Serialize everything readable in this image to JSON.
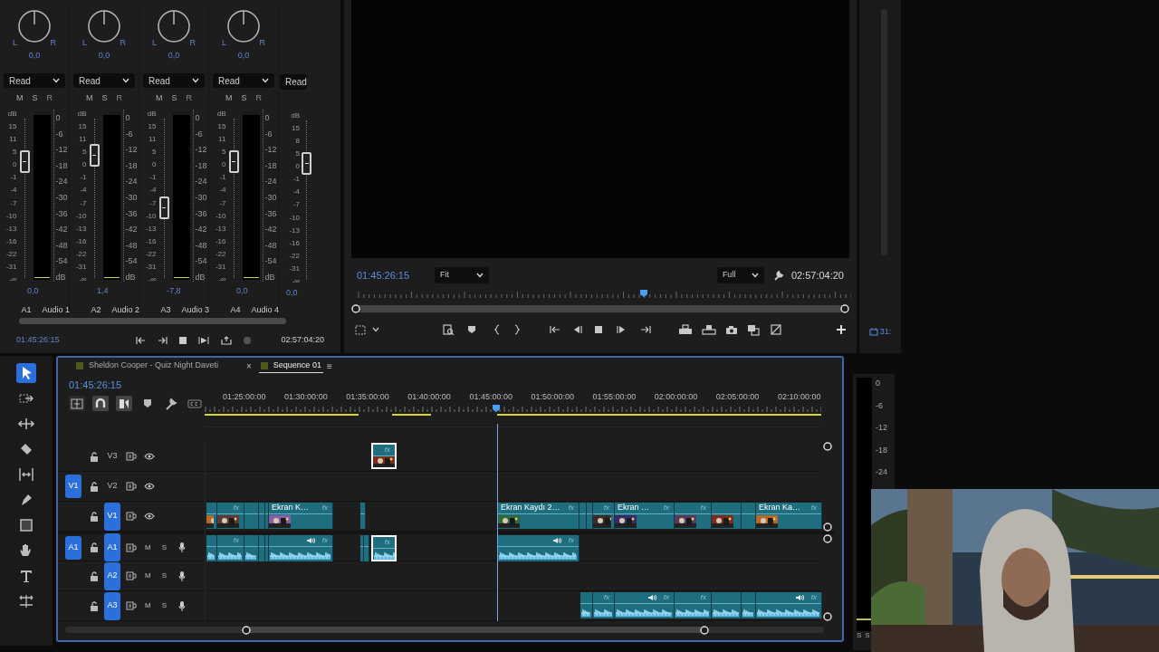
{
  "audio_mixer": {
    "channels": [
      {
        "pan": "0,0",
        "pan_left": "L",
        "pan_right": "R",
        "automation": "Read",
        "mute": "M",
        "solo": "S",
        "record": "R",
        "fader_scale": [
          "dB",
          "15",
          "11",
          "5",
          "0",
          "-1",
          "-4",
          "-7",
          "-10",
          "-13",
          "-16",
          "-22",
          "-31",
          "-∞"
        ],
        "fader": {
          "level": 0.73
        },
        "meter_scale": [
          "0",
          "-6",
          "-12",
          "-18",
          "-24",
          "-30",
          "-36",
          "-42",
          "-48",
          "-54",
          "dB"
        ],
        "value": "0,0",
        "track": "A1",
        "name": "Audio 1"
      },
      {
        "pan": "0,0",
        "pan_left": "L",
        "pan_right": "R",
        "automation": "Read",
        "mute": "M",
        "solo": "S",
        "record": "R",
        "fader_scale": [
          "dB",
          "15",
          "11",
          "5",
          "0",
          "-1",
          "-4",
          "-7",
          "-10",
          "-13",
          "-16",
          "-22",
          "-31",
          "-∞"
        ],
        "fader": {
          "level": 0.77
        },
        "meter_scale": [
          "0",
          "-6",
          "-12",
          "-18",
          "-24",
          "-30",
          "-36",
          "-42",
          "-48",
          "-54",
          "dB"
        ],
        "value": "1,4",
        "track": "A2",
        "name": "Audio 2"
      },
      {
        "pan": "0,0",
        "pan_left": "L",
        "pan_right": "R",
        "automation": "Read",
        "mute": "M",
        "solo": "S",
        "record": "R",
        "fader_scale": [
          "dB",
          "15",
          "11",
          "5",
          "0",
          "-1",
          "-4",
          "-7",
          "-10",
          "-13",
          "-16",
          "-22",
          "-31",
          "-∞"
        ],
        "fader": {
          "level": 0.44
        },
        "meter_scale": [
          "0",
          "-6",
          "-12",
          "-18",
          "-24",
          "-30",
          "-36",
          "-42",
          "-48",
          "-54",
          "dB"
        ],
        "value": "-7,8",
        "track": "A3",
        "name": "Audio 3"
      },
      {
        "pan": "0,0",
        "pan_left": "L",
        "pan_right": "R",
        "automation": "Read",
        "mute": "M",
        "solo": "S",
        "record": "R",
        "fader_scale": [
          "dB",
          "15",
          "11",
          "5",
          "0",
          "-1",
          "-4",
          "-7",
          "-10",
          "-13",
          "-16",
          "-22",
          "-31",
          "-∞"
        ],
        "fader": {
          "level": 0.73
        },
        "meter_scale": [
          "0",
          "-6",
          "-12",
          "-18",
          "-24",
          "-30",
          "-36",
          "-42",
          "-48",
          "-54",
          "dB"
        ],
        "value": "0,0",
        "track": "A4",
        "name": "Audio 4"
      },
      {
        "automation": "Read",
        "fader_scale": [
          "dB",
          "15",
          "8",
          "5",
          "0",
          "-1",
          "-4",
          "-7",
          "-10",
          "-13",
          "-16",
          "-22",
          "-31",
          "-∞"
        ],
        "fader": {
          "level": 0.73
        },
        "value": "0,0"
      }
    ],
    "current_time": "01:45:26:15",
    "duration": "02:57:04:20"
  },
  "program_monitor": {
    "current_time": "01:45:26:15",
    "zoom": "Fit",
    "quality": "Full",
    "duration": "02:57:04:20",
    "playhead": {
      "level": 0.59
    }
  },
  "side_panel": {
    "timecode": "31:"
  },
  "tools": [
    {
      "kind": "selection",
      "selected": true
    },
    {
      "kind": "track-select",
      "selected": false
    },
    {
      "kind": "ripple",
      "selected": false
    },
    {
      "kind": "razor",
      "selected": false
    },
    {
      "kind": "slip",
      "selected": false
    },
    {
      "kind": "pen",
      "selected": false
    },
    {
      "kind": "rectangle",
      "selected": false
    },
    {
      "kind": "hand",
      "selected": false
    },
    {
      "kind": "type",
      "selected": false
    },
    {
      "kind": "remix",
      "selected": false
    }
  ],
  "timeline": {
    "tabs": [
      {
        "label": "Sheldon Cooper - Quiz Night Daveti",
        "selected": false
      },
      {
        "label": "Sequence 01",
        "selected": true,
        "close": "×",
        "menu": "≡"
      }
    ],
    "current_time": "01:45:26:15",
    "toolbar": [
      {
        "kind": "nest",
        "on": false
      },
      {
        "kind": "snap",
        "on": true
      },
      {
        "kind": "linked",
        "on": true
      },
      {
        "kind": "marker",
        "on": false
      },
      {
        "kind": "settings",
        "on": false
      },
      {
        "kind": "captions",
        "on": false
      }
    ],
    "ruler": [
      "01:25:00:00",
      "01:30:00:00",
      "01:35:00:00",
      "01:40:00:00",
      "01:45:00:00",
      "01:50:00:00",
      "01:55:00:00",
      "02:00:00:00",
      "02:05:00:00",
      "02:10:00:00"
    ],
    "playhead": {
      "level": 0.473
    },
    "tracks": [
      {
        "label": "V3",
        "kind": "video",
        "targeted": false,
        "clips": [
          {
            "selected": true,
            "badge": "fx",
            "thumbnail": true
          }
        ]
      },
      {
        "label": "V2",
        "kind": "video",
        "targeted": false,
        "source": "V1"
      },
      {
        "label": "V1",
        "kind": "video",
        "targeted": true,
        "clips": [
          {
            "selected": false,
            "thumbnail": true
          },
          {
            "selected": false,
            "badge": "fx",
            "thumbnail": true
          },
          {
            "selected": false
          },
          {
            "selected": false
          },
          {
            "selected": false
          },
          {
            "selected": false,
            "label": "Ekran K…",
            "badge": "fx",
            "thumbnail": true
          },
          {
            "selected": false
          },
          {
            "selected": false,
            "label": "Ekran Kaydı 2…",
            "badge": "fx",
            "thumbnail": true
          },
          {
            "selected": false
          },
          {
            "selected": false
          },
          {
            "selected": false,
            "badge": "fx",
            "thumbnail": true
          },
          {
            "selected": false,
            "label": "Ekran …",
            "badge": "fx",
            "thumbnail": true
          },
          {
            "selected": false,
            "badge": "fx",
            "thumbnail": true
          },
          {
            "selected": false,
            "thumbnail": true
          },
          {
            "selected": false
          },
          {
            "selected": false,
            "label": "Ekran Ka…",
            "badge": "fx",
            "thumbnail": true
          }
        ]
      },
      {
        "label": "A1",
        "kind": "audio",
        "targeted": true,
        "source": "A1",
        "mute": "M",
        "solo": "S",
        "clips": [
          {
            "selected": false
          },
          {
            "selected": false,
            "badge": "fx"
          },
          {
            "selected": false
          },
          {
            "selected": false
          },
          {
            "selected": false
          },
          {
            "selected": false,
            "badge": "fx",
            "speaker": true
          },
          {
            "selected": false
          },
          {
            "selected": false
          },
          {
            "selected": true,
            "badge": "fx"
          },
          {
            "selected": false,
            "badge": "fx",
            "speaker": true
          }
        ]
      },
      {
        "label": "A2",
        "kind": "audio",
        "targeted": true,
        "mute": "M",
        "solo": "S"
      },
      {
        "label": "A3",
        "kind": "audio",
        "targeted": true,
        "mute": "M",
        "solo": "S",
        "clips": [
          {
            "selected": false
          },
          {
            "selected": false,
            "badge": "fx"
          },
          {
            "selected": false,
            "badge": "fx",
            "speaker": true
          },
          {
            "selected": false,
            "badge": "fx"
          },
          {
            "selected": false
          },
          {
            "selected": false
          },
          {
            "selected": false,
            "badge": "fx",
            "speaker": true
          }
        ]
      }
    ]
  },
  "master_meter": {
    "scale": [
      "0",
      "-6",
      "-12",
      "-18",
      "-24"
    ],
    "solo_left": "S",
    "solo_right": "S"
  }
}
